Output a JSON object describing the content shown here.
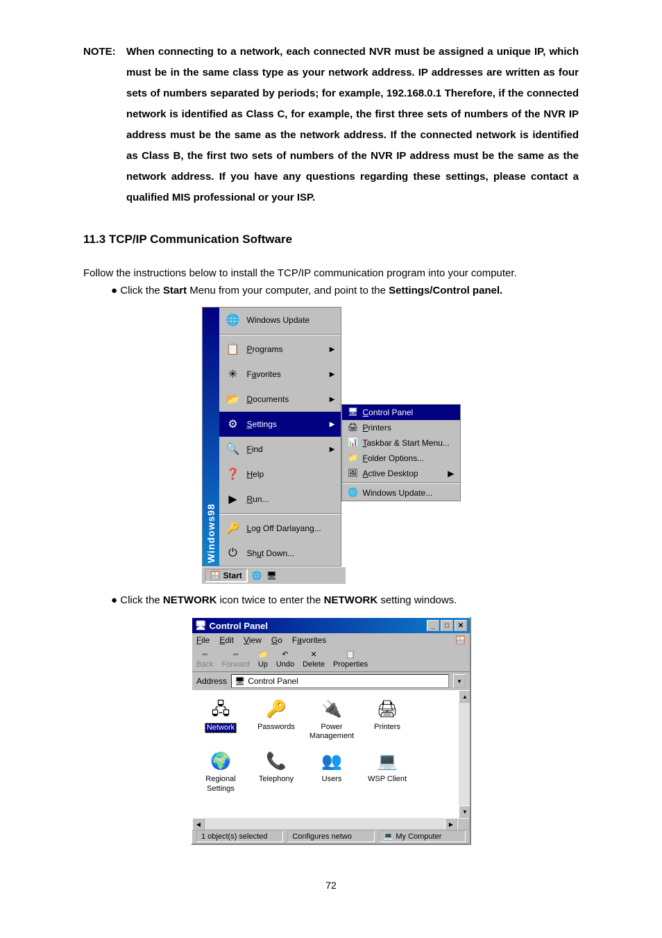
{
  "note": {
    "label": "NOTE:",
    "body": "When connecting to a network, each connected NVR must be assigned a unique IP, which must be in the same class type as your network address. IP addresses are written as four sets of numbers separated by periods; for example, 192.168.0.1 Therefore, if the connected network is identified as Class C, for example, the first three sets of numbers of the NVR IP address must be the same as the network address. If the connected network is identified as Class B, the first two sets of numbers of the NVR IP address must be the same as the network address. If you have any questions regarding these settings, please contact a qualified MIS professional or your ISP."
  },
  "section_heading": "11.3 TCP/IP Communication Software",
  "instruction1": "Follow the instructions below to install the TCP/IP communication program into your computer.",
  "bullet1_pre": "Click the ",
  "bullet1_bold1": "Start",
  "bullet1_mid": " Menu from your computer, and point to the ",
  "bullet1_bold2": "Settings/Control panel.",
  "bullet2_pre": "Click the ",
  "bullet2_bold1": "NETWORK",
  "bullet2_mid": " icon twice to enter the ",
  "bullet2_bold2": "NETWORK",
  "bullet2_post": " setting windows.",
  "start_menu": {
    "os_label": "Windows98",
    "items": [
      {
        "label": "Windows Update",
        "icon": "🌐"
      },
      {
        "label": "Programs",
        "icon": "📋",
        "arrow": true,
        "underline": "P"
      },
      {
        "label": "Favorites",
        "icon": "✳",
        "arrow": true,
        "underline": "a"
      },
      {
        "label": "Documents",
        "icon": "📂",
        "arrow": true,
        "underline": "D"
      },
      {
        "label": "Settings",
        "icon": "⚙",
        "arrow": true,
        "highlighted": true,
        "underline": "S"
      },
      {
        "label": "Find",
        "icon": "🔍",
        "arrow": true,
        "underline": "F"
      },
      {
        "label": "Help",
        "icon": "❓",
        "underline": "H"
      },
      {
        "label": "Run...",
        "icon": "▶",
        "underline": "R"
      },
      {
        "label": "Log Off Darlayang...",
        "icon": "🔑",
        "underline": "L"
      },
      {
        "label": "Shut Down...",
        "icon": "⏻",
        "underline": "u"
      }
    ],
    "submenu": [
      {
        "label": "Control Panel",
        "icon": "🖥",
        "highlighted": true,
        "underline": "C"
      },
      {
        "label": "Printers",
        "icon": "🖨",
        "underline": "P"
      },
      {
        "label": "Taskbar & Start Menu...",
        "icon": "📊",
        "underline": "T"
      },
      {
        "label": "Folder Options...",
        "icon": "📁",
        "underline": "F"
      },
      {
        "label": "Active Desktop",
        "icon": "🖼",
        "arrow": true,
        "underline": "A"
      },
      {
        "label": "Windows Update...",
        "icon": "🌐"
      }
    ],
    "taskbar": {
      "start_label": "Start"
    }
  },
  "control_panel": {
    "title": "Control Panel",
    "menus": [
      "File",
      "Edit",
      "View",
      "Go",
      "Favorites"
    ],
    "menu_underlines": [
      "F",
      "E",
      "V",
      "G",
      "a"
    ],
    "toolbar": [
      {
        "label": "Back",
        "icon": "⬅",
        "enabled": false
      },
      {
        "label": "Forward",
        "icon": "➡",
        "enabled": false
      },
      {
        "label": "Up",
        "icon": "📁",
        "enabled": true
      },
      {
        "label": "Undo",
        "icon": "↶",
        "enabled": true
      },
      {
        "label": "Delete",
        "icon": "✕",
        "enabled": true
      },
      {
        "label": "Properties",
        "icon": "📋",
        "enabled": true
      }
    ],
    "address_label": "Address",
    "address_value": "Control Panel",
    "icons": [
      {
        "label": "Network",
        "icon": "🖧",
        "selected": true
      },
      {
        "label": "Passwords",
        "icon": "🔑"
      },
      {
        "label": "Power Management",
        "icon": "🔌"
      },
      {
        "label": "Printers",
        "icon": "🖨"
      },
      {
        "label": "Regional Settings",
        "icon": "🌍"
      },
      {
        "label": "Telephony",
        "icon": "📞"
      },
      {
        "label": "Users",
        "icon": "👥"
      },
      {
        "label": "WSP Client",
        "icon": "💻"
      }
    ],
    "status_left": "1 object(s) selected",
    "status_mid": "Configures netwo",
    "status_right": "My Computer"
  },
  "page_number": "72"
}
